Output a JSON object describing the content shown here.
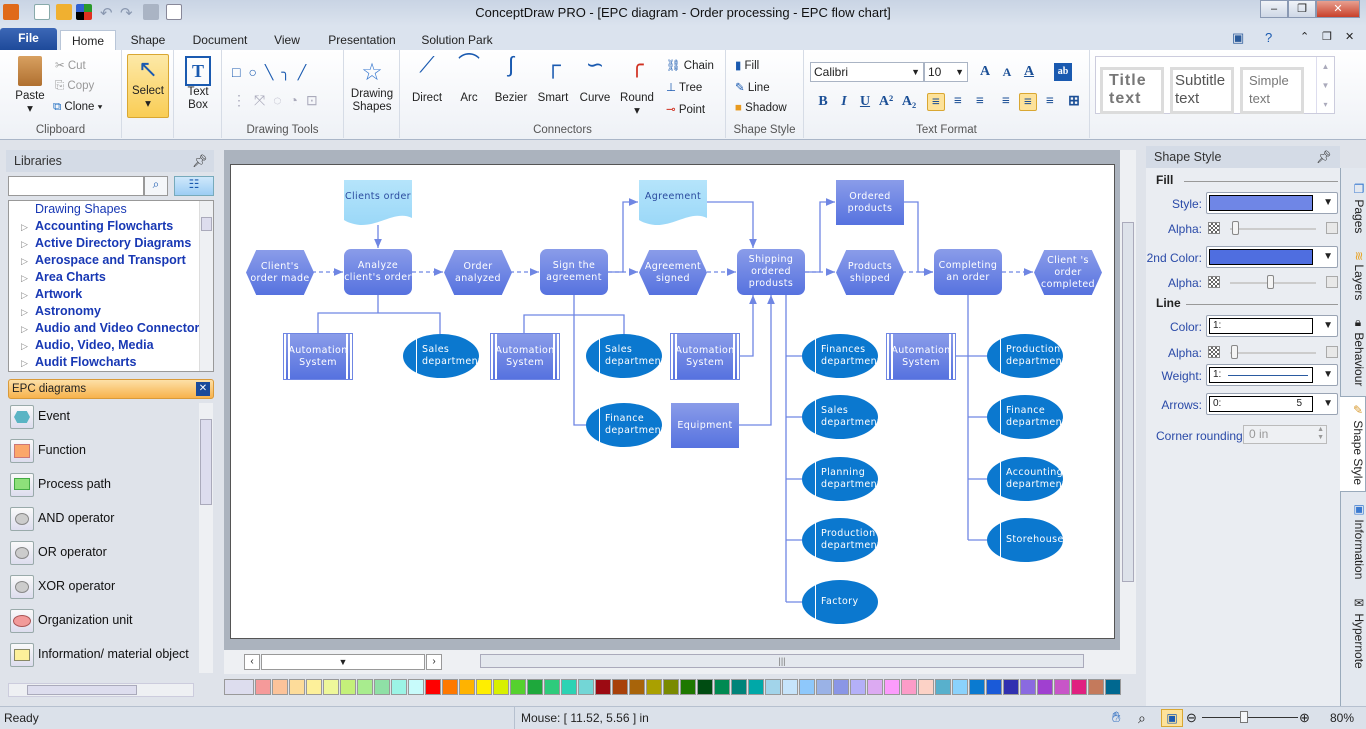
{
  "window": {
    "title": "ConceptDraw PRO - [EPC diagram - Order processing - EPC flow chart]",
    "minimize": "‒",
    "restore": "❐",
    "close": "✕"
  },
  "tabs": {
    "file": "File",
    "items": [
      "Home",
      "Shape",
      "Document",
      "View",
      "Presentation",
      "Solution Park"
    ]
  },
  "ribbon": {
    "clipboard": {
      "paste": "Paste",
      "cut": "Cut",
      "copy": "Copy",
      "clone": "Clone",
      "label": "Clipboard"
    },
    "select": "Select",
    "textbox": [
      "Text",
      "Box"
    ],
    "drawing_tools": "Drawing Tools",
    "drawing_shapes": [
      "Drawing",
      "Shapes"
    ],
    "connectors": {
      "items": [
        "Direct",
        "Arc",
        "Bezier",
        "Smart",
        "Curve",
        "Round"
      ],
      "chain": "Chain",
      "tree": "Tree",
      "point": "Point",
      "label": "Connectors"
    },
    "shape_style": {
      "fill": "Fill",
      "line": "Line",
      "shadow": "Shadow",
      "label": "Shape Style"
    },
    "text_format": {
      "font": "Calibri",
      "size": "10",
      "label": "Text Format",
      "bold": "B",
      "italic": "I",
      "underline": "U"
    },
    "styles": [
      {
        "l1": "Title",
        "l2": "text"
      },
      {
        "l1": "Subtitle",
        "l2": "text"
      },
      {
        "l1": "Simple",
        "l2": "text"
      }
    ]
  },
  "libraries": {
    "title": "Libraries",
    "search_placeholder": "",
    "items": [
      "Drawing Shapes",
      "Accounting Flowcharts",
      "Active Directory Diagrams",
      "Aerospace and Transport",
      "Area Charts",
      "Artwork",
      "Astronomy",
      "Audio and Video Connectors",
      "Audio, Video, Media",
      "Audit Flowcharts"
    ]
  },
  "epc": {
    "title": "EPC diagrams",
    "items": [
      "Event",
      "Function",
      "Process path",
      "AND operator",
      "OR operator",
      "XOR operator",
      "Organization unit",
      "Information/ material object"
    ]
  },
  "diagram": {
    "events": [
      "Client's order made",
      "Order analyzed",
      "Agreement signed",
      "Products shipped",
      "Client 's order completed"
    ],
    "functions": [
      "Analyze client's order",
      "Sign the agreement",
      "Shipping ordered produsts",
      "Completing an order"
    ],
    "documents": [
      "Clients order",
      "Agreement"
    ],
    "ordered_products": "Ordered products",
    "equipment": "Equipment",
    "automation": "Automation System",
    "orgs_a": [
      "Sales department",
      "Sales department",
      "Finance department"
    ],
    "orgs_b": [
      "Finances department",
      "Sales department",
      "Planning department",
      "Production department",
      "Factory"
    ],
    "orgs_c": [
      "Production department",
      "Finance department",
      "Accounting department",
      "Storehouse"
    ]
  },
  "shape_style": {
    "title": "Shape Style",
    "fill": "Fill",
    "style": "Style:",
    "alpha": "Alpha:",
    "second_color": "2nd Color:",
    "line": "Line",
    "color": "Color:",
    "color_value": "1:",
    "weight": "Weight:",
    "weight_value": "1:",
    "arrows": "Arrows:",
    "arrows_value": "0:",
    "arrows_end": "5",
    "corner_rounding": "Corner rounding:",
    "corner_value": "0 in",
    "fill_color": "#6f86e6",
    "second_color_value": "#4f6ee0",
    "alpha1": 0.05,
    "alpha2": 0.45,
    "alpha3": 0.03
  },
  "side_tabs": [
    "Pages",
    "Layers",
    "Behaviour",
    "Shape Style",
    "Information",
    "Hypernote"
  ],
  "palette": [
    "#f59a9a",
    "#fcc39a",
    "#fddc9a",
    "#fdf09a",
    "#eef79a",
    "#c4f07a",
    "#a8ec8e",
    "#8fe0a6",
    "#9cf4e6",
    "#c8fbfb",
    "#ff0000",
    "#ff7800",
    "#ffb300",
    "#ffee00",
    "#d8f000",
    "#55d12e",
    "#1ea83c",
    "#2ecb7c",
    "#2bd3b4",
    "#73d6d6",
    "#9c0a12",
    "#a8400a",
    "#a8640a",
    "#aaa000",
    "#7a8a00",
    "#1e7800",
    "#004c12",
    "#008a52",
    "#00847a",
    "#00a8a8",
    "#a2d4ea",
    "#c6e4fb",
    "#8ec8fb",
    "#9ab2e6",
    "#8a96e6",
    "#b4b0f8",
    "#dcaaf2",
    "#fc9cfc",
    "#fc9cc8",
    "#fcd2c6",
    "#58b0cc",
    "#8ad2fc",
    "#0a7ad0",
    "#1a5ad8",
    "#3030b0",
    "#8a6ae0",
    "#a040d0",
    "#c855c8",
    "#e02080",
    "#c47a5c",
    "#006890"
  ],
  "status": {
    "ready": "Ready",
    "mouse": "Mouse: [ 11.52, 5.56 ] in",
    "zoom": "80%",
    "zoom_value": 80
  }
}
